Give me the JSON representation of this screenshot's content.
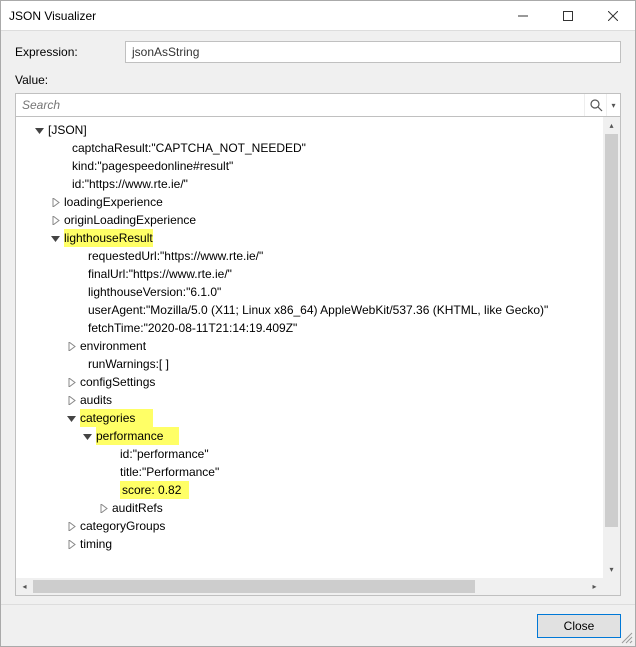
{
  "window": {
    "title": "JSON Visualizer"
  },
  "labels": {
    "expression": "Expression:",
    "value": "Value:"
  },
  "expression": {
    "value": "jsonAsString"
  },
  "search": {
    "placeholder": "Search"
  },
  "tree": {
    "root": "[JSON]",
    "captchaResult": {
      "key": "captchaResult: ",
      "val": "\"CAPTCHA_NOT_NEEDED\""
    },
    "kind": {
      "key": "kind: ",
      "val": "\"pagespeedonline#result\""
    },
    "id": {
      "key": "id: ",
      "val": "\"https://www.rte.ie/\""
    },
    "loadingExperience": "loadingExperience",
    "originLoadingExperience": "originLoadingExperience",
    "lighthouseResult": "lighthouseResult",
    "requestedUrl": {
      "key": "requestedUrl: ",
      "val": "\"https://www.rte.ie/\""
    },
    "finalUrl": {
      "key": "finalUrl: ",
      "val": "\"https://www.rte.ie/\""
    },
    "lighthouseVersion": {
      "key": "lighthouseVersion: ",
      "val": "\"6.1.0\""
    },
    "userAgent": {
      "key": "userAgent: ",
      "val": "\"Mozilla/5.0 (X11; Linux x86_64) AppleWebKit/537.36 (KHTML, like Gecko)\""
    },
    "fetchTime": {
      "key": "fetchTime: ",
      "val": "\"2020-08-11T21:14:19.409Z\""
    },
    "environment": "environment",
    "runWarnings": {
      "key": "runWarnings: ",
      "val": "[ ]"
    },
    "configSettings": "configSettings",
    "audits": "audits",
    "categories": "categories",
    "performance": "performance",
    "perfId": {
      "key": "id: ",
      "val": "\"performance\""
    },
    "perfTitle": {
      "key": "title: ",
      "val": "\"Performance\""
    },
    "score": {
      "key": "score: ",
      "val": "0.82"
    },
    "auditRefs": "auditRefs",
    "categoryGroups": "categoryGroups",
    "timing": "timing"
  },
  "footer": {
    "close": "Close"
  }
}
